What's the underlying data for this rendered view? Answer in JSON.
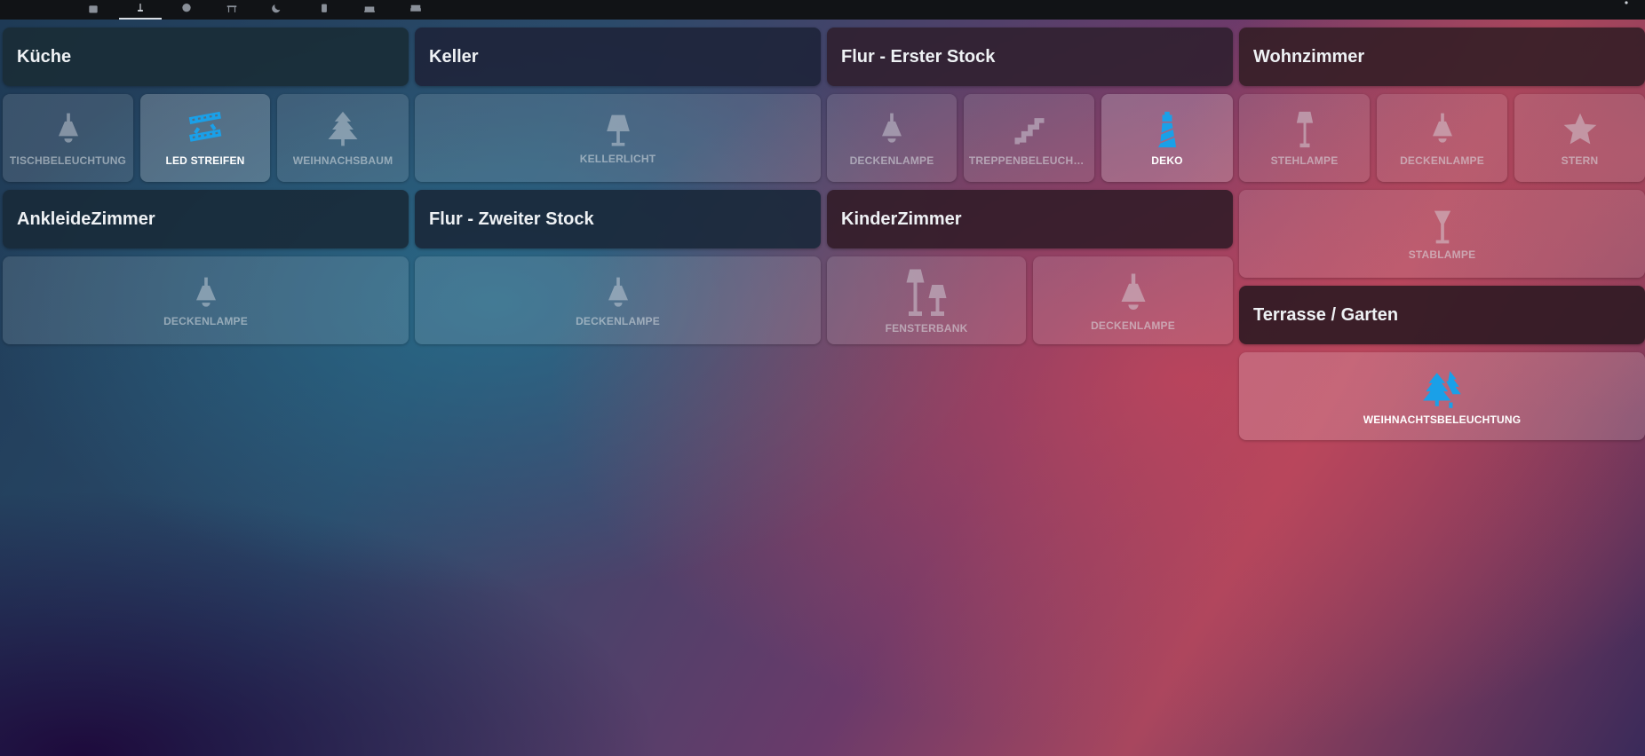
{
  "colors": {
    "accent": "#1aa0e8",
    "topbar": "#111316"
  },
  "topbar": {
    "tabs": [
      {
        "icon": "box-icon"
      },
      {
        "icon": "lamp-icon",
        "active": true
      },
      {
        "icon": "circle-icon"
      },
      {
        "icon": "table-icon"
      },
      {
        "icon": "moon-icon"
      },
      {
        "icon": "phone-icon"
      },
      {
        "icon": "sofa-icon"
      },
      {
        "icon": "bed-icon"
      }
    ],
    "menu_icon": "more-vertical-icon"
  },
  "rooms": {
    "kueche": {
      "title": "Küche",
      "tiles": [
        {
          "label": "TISCHBELEUCHTUNG",
          "icon": "ceiling-lamp-icon",
          "on": false
        },
        {
          "label": "LED STREIFEN",
          "icon": "led-strip-icon",
          "on": true
        },
        {
          "label": "WEIHNACHSBAUM",
          "icon": "pine-tree-icon",
          "on": false
        }
      ]
    },
    "keller": {
      "title": "Keller",
      "tiles": [
        {
          "label": "KELLERLICHT",
          "icon": "table-lamp-icon",
          "on": false
        }
      ]
    },
    "flur1": {
      "title": "Flur - Erster Stock",
      "tiles": [
        {
          "label": "DECKENLAMPE",
          "icon": "ceiling-lamp-icon",
          "on": false
        },
        {
          "label": "TREPPENBELEUCHTU...",
          "icon": "stairs-icon",
          "on": false
        },
        {
          "label": "DEKO",
          "icon": "lighthouse-icon",
          "on": true
        }
      ]
    },
    "wohnzimmer": {
      "title": "Wohnzimmer",
      "tiles": [
        {
          "label": "STEHLAMPE",
          "icon": "floor-lamp-icon",
          "on": false
        },
        {
          "label": "DECKENLAMPE",
          "icon": "ceiling-lamp-icon",
          "on": false
        },
        {
          "label": "STERN",
          "icon": "star-icon",
          "on": false
        },
        {
          "label": "STABLAMPE",
          "icon": "torch-lamp-icon",
          "on": false
        }
      ]
    },
    "ankleide": {
      "title": "AnkleideZimmer",
      "tiles": [
        {
          "label": "DECKENLAMPE",
          "icon": "ceiling-lamp-icon",
          "on": false
        }
      ]
    },
    "flur2": {
      "title": "Flur - Zweiter Stock",
      "tiles": [
        {
          "label": "DECKENLAMPE",
          "icon": "ceiling-lamp-icon",
          "on": false
        }
      ]
    },
    "kinder": {
      "title": "KinderZimmer",
      "tiles": [
        {
          "label": "FENSTERBANK",
          "icon": "lamps-icon",
          "on": false
        },
        {
          "label": "DECKENLAMPE",
          "icon": "ceiling-lamp-icon",
          "on": false
        }
      ]
    },
    "terrasse": {
      "title": "Terrasse / Garten",
      "tiles": [
        {
          "label": "WEIHNACHTSBELEUCHTUNG",
          "icon": "pine-trees-icon",
          "on": true
        }
      ]
    }
  }
}
